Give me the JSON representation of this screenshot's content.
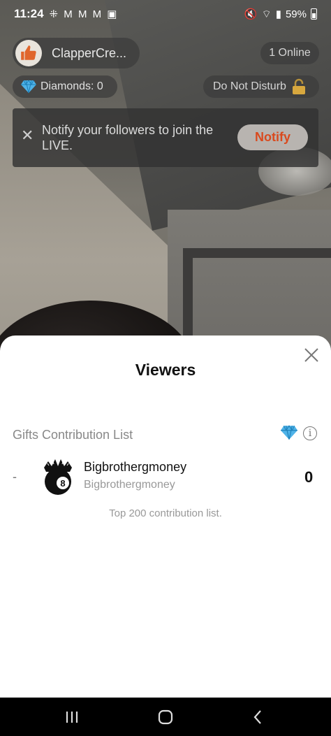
{
  "status_bar": {
    "time": "11:24",
    "notification_icons": "⁜ M M M ▣",
    "battery": "59%"
  },
  "live": {
    "host_name": "ClapperCre...",
    "online": "1 Online",
    "diamonds": "Diamonds: 0",
    "do_not_disturb": "Do Not Disturb",
    "notify_banner": {
      "text": "Notify your followers to join the LIVE.",
      "button": "Notify"
    }
  },
  "sheet": {
    "title": "Viewers",
    "list_heading": "Gifts Contribution List",
    "rows": [
      {
        "rank": "-",
        "name": "Bigbrothergmoney",
        "username": "Bigbrothergmoney",
        "value": "0"
      }
    ],
    "footnote": "Top 200 contribution list."
  },
  "colors": {
    "accent": "#d94a1e",
    "diamond": "#4fb3e8"
  },
  "icons": [
    "thumbs-up-icon",
    "diamond-icon",
    "lock-icon",
    "close-icon",
    "info-icon",
    "eight-ball-avatar-icon",
    "recents-icon",
    "home-icon",
    "back-icon"
  ]
}
